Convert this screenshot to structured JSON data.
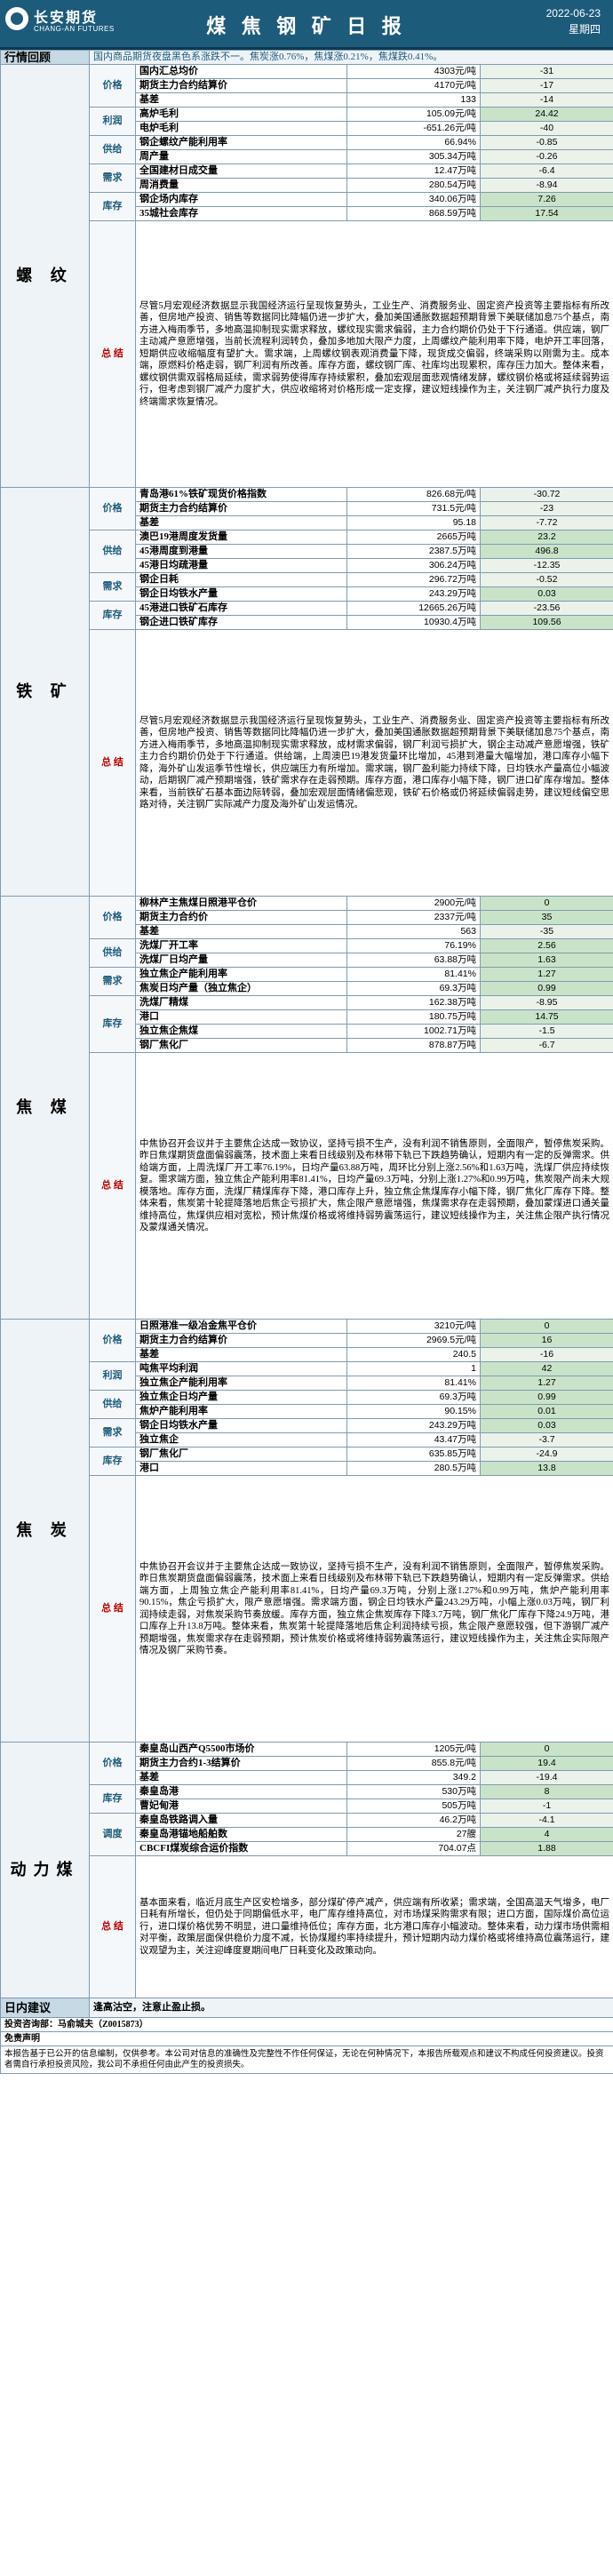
{
  "header": {
    "brand_cn": "长安期货",
    "brand_en": "CHANG-AN FUTURES",
    "title": "煤 焦 钢 矿 日 报",
    "date": "2022-06-23",
    "weekday": "星期四"
  },
  "review": {
    "label": "行情回顾",
    "text": "国内商品期货夜盘黑色系涨跌不一。焦炭涨0.76%，焦煤涨0.21%，焦煤跌0.41%。"
  },
  "sections": [
    {
      "name": "螺 纹",
      "rows": [
        {
          "cat": "价格",
          "item": "国内汇总均价",
          "value": "4303元/吨",
          "change": "-31"
        },
        {
          "cat": "",
          "item": "期货主力合约结算价",
          "value": "4170元/吨",
          "change": "-17"
        },
        {
          "cat": "",
          "item": "基差",
          "value": "133",
          "change": "-14"
        },
        {
          "cat": "利润",
          "item": "高炉毛利",
          "value": "105.09元/吨",
          "change": "24.42"
        },
        {
          "cat": "",
          "item": "电炉毛利",
          "value": "-651.26元/吨",
          "change": "-40"
        },
        {
          "cat": "供给",
          "item": "钢企螺纹产能利用率",
          "value": "66.94%",
          "change": "-0.85"
        },
        {
          "cat": "",
          "item": "周产量",
          "value": "305.34万吨",
          "change": "-0.26"
        },
        {
          "cat": "需求",
          "item": "全国建材日成交量",
          "value": "12.47万吨",
          "change": "-6.4"
        },
        {
          "cat": "",
          "item": "周消费量",
          "value": "280.54万吨",
          "change": "-8.94"
        },
        {
          "cat": "库存",
          "item": "钢企场内库存",
          "value": "340.06万吨",
          "change": "7.26"
        },
        {
          "cat": "",
          "item": "35城社会库存",
          "value": "868.59万吨",
          "change": "17.54"
        }
      ],
      "summary": "尽管5月宏观经济数据显示我国经济运行呈现恢复势头，工业生产、消费服务业、固定资产投资等主要指标有所改善，但房地产投资、销售等数据同比降幅仍进一步扩大，叠加美国通胀数据超预期背景下美联储加息75个基点，南方进入梅雨季节，多地高温抑制现实需求释放，螺纹现实需求偏弱，主力合约期价仍处于下行通道。供应端，钢厂主动减产意愿增强，当前长流程利润转负，叠加多地加大限产力度，上周螺纹产能利用率下降，电炉开工率回落，短期供应收缩幅度有望扩大。需求端，上周螺纹钢表观消费量下降，现货成交偏弱，终端采购以刚需为主。成本端，原燃料价格走弱，钢厂利润有所改善。库存方面，螺纹钢厂库、社库均出现累积，库存压力加大。整体来看，螺纹钢供需双弱格局延续，需求弱势使得库存持续累积，叠加宏观层面悲观情绪发酵，螺纹钢价格或将延续弱势运行，但考虑到钢厂减产力度扩大，供应收缩将对价格形成一定支撑，建议短线操作为主，关注钢厂减产执行力度及终端需求恢复情况。"
    },
    {
      "name": "铁 矿",
      "rows": [
        {
          "cat": "价格",
          "item": "青岛港61%铁矿现货价格指数",
          "value": "826.68元/吨",
          "change": "-30.72"
        },
        {
          "cat": "",
          "item": "期货主力合约结算价",
          "value": "731.5元/吨",
          "change": "-23"
        },
        {
          "cat": "",
          "item": "基差",
          "value": "95.18",
          "change": "-7.72"
        },
        {
          "cat": "供给",
          "item": "澳巴19港周度发货量",
          "value": "2665万吨",
          "change": "23.2"
        },
        {
          "cat": "",
          "item": "45港周度到港量",
          "value": "2387.5万吨",
          "change": "496.8"
        },
        {
          "cat": "",
          "item": "45港日均疏港量",
          "value": "306.24万吨",
          "change": "-12.35"
        },
        {
          "cat": "需求",
          "item": "钢企日耗",
          "value": "296.72万吨",
          "change": "-0.52"
        },
        {
          "cat": "",
          "item": "钢企日均铁水产量",
          "value": "243.29万吨",
          "change": "0.03"
        },
        {
          "cat": "库存",
          "item": "45港进口铁矿石库存",
          "value": "12665.26万吨",
          "change": "-23.56"
        },
        {
          "cat": "",
          "item": "钢企进口铁矿库存",
          "value": "10930.4万吨",
          "change": "109.56"
        }
      ],
      "summary": "尽管5月宏观经济数据显示我国经济运行呈现恢复势头，工业生产、消费服务业、固定资产投资等主要指标有所改善，但房地产投资、销售等数据同比降幅仍进一步扩大，叠加美国通胀数据超预期背景下美联储加息75个基点，南方进入梅雨季节，多地高温抑制现实需求释放，成材需求偏弱，钢厂利润亏损扩大，钢企主动减产意愿增强，铁矿主力合约期价仍处于下行通道。供给端，上周澳巴19港发货量环比增加，45港到港量大幅增加，港口库存小幅下降，海外矿山发运季节性增长，供应端压力有所增加。需求端，钢厂盈利能力持续下降，日均铁水产量高位小幅波动，后期钢厂减产预期增强，铁矿需求存在走弱预期。库存方面，港口库存小幅下降，钢厂进口矿库存增加。整体来看，当前铁矿石基本面边际转弱，叠加宏观层面情绪偏悲观，铁矿石价格或仍将延续偏弱走势，建议短线偏空思路对待，关注钢厂实际减产力度及海外矿山发运情况。"
    },
    {
      "name": "焦 煤",
      "rows": [
        {
          "cat": "价格",
          "item": "柳林产主焦煤日照港平仓价",
          "value": "2900元/吨",
          "change": "0"
        },
        {
          "cat": "",
          "item": "期货主力合约价",
          "value": "2337元/吨",
          "change": "35"
        },
        {
          "cat": "",
          "item": "基差",
          "value": "563",
          "change": "-35"
        },
        {
          "cat": "供给",
          "item": "洗煤厂开工率",
          "value": "76.19%",
          "change": "2.56"
        },
        {
          "cat": "",
          "item": "洗煤厂日均产量",
          "value": "63.88万吨",
          "change": "1.63"
        },
        {
          "cat": "需求",
          "item": "独立焦企产能利用率",
          "value": "81.41%",
          "change": "1.27"
        },
        {
          "cat": "",
          "item": "焦炭日均产量（独立焦企）",
          "value": "69.3万吨",
          "change": "0.99"
        },
        {
          "cat": "库存",
          "item": "洗煤厂精煤",
          "value": "162.38万吨",
          "change": "-8.95"
        },
        {
          "cat": "",
          "item": "港口",
          "value": "180.75万吨",
          "change": "14.75"
        },
        {
          "cat": "",
          "item": "独立焦企焦煤",
          "value": "1002.71万吨",
          "change": "-1.5"
        },
        {
          "cat": "",
          "item": "钢厂焦化厂",
          "value": "878.87万吨",
          "change": "-6.7"
        }
      ],
      "summary": "中焦协召开会议并于主要焦企达成一致协议，坚持亏损不生产，没有利润不销售原则，全面限产，暂停焦炭采购。昨日焦煤期货盘面偏弱震荡，技术面上来看日线级别及布林带下轨已下跌趋势确认，短期内有一定的反弹需求。供给端方面，上周洗煤厂开工率76.19%，日均产量63.88万吨，周环比分别上涨2.56%和1.63万吨，洗煤厂供应持续恢复。需求端方面，独立焦企产能利用率81.41%，日均产量69.3万吨，分别上涨1.27%和0.99万吨，焦炭限产尚未大规模落地。库存方面，洗煤厂精煤库存下降，港口库存上升，独立焦企焦煤库存小幅下降，钢厂焦化厂库存下降。整体来看，焦炭第十轮提降落地后焦企亏损扩大，焦企限产意愿增强，焦煤需求存在走弱预期，叠加蒙煤进口通关量维持高位，焦煤供应相对宽松，预计焦煤价格或将维持弱势震荡运行，建议短线操作为主，关注焦企限产执行情况及蒙煤通关情况。"
    },
    {
      "name": "焦 炭",
      "rows": [
        {
          "cat": "价格",
          "item": "日照港准一级冶金焦平仓价",
          "value": "3210元/吨",
          "change": "0"
        },
        {
          "cat": "",
          "item": "期货主力合约结算价",
          "value": "2969.5元/吨",
          "change": "16"
        },
        {
          "cat": "",
          "item": "基差",
          "value": "240.5",
          "change": "-16"
        },
        {
          "cat": "利润",
          "item": "吨焦平均利润",
          "value": "1",
          "change": "42"
        },
        {
          "cat": "",
          "item": "独立焦企产能利用率",
          "value": "81.41%",
          "change": "1.27"
        },
        {
          "cat": "供给",
          "item": "独立焦企日均产量",
          "value": "69.3万吨",
          "change": "0.99"
        },
        {
          "cat": "",
          "item": "焦炉产能利用率",
          "value": "90.15%",
          "change": "0.01"
        },
        {
          "cat": "需求",
          "item": "钢企日均铁水产量",
          "value": "243.29万吨",
          "change": "0.03"
        },
        {
          "cat": "",
          "item": "独立焦企",
          "value": "43.47万吨",
          "change": "-3.7"
        },
        {
          "cat": "库存",
          "item": "钢厂焦化厂",
          "value": "635.85万吨",
          "change": "-24.9"
        },
        {
          "cat": "",
          "item": "港口",
          "value": "280.5万吨",
          "change": "13.8"
        }
      ],
      "summary": "中焦协召开会议并于主要焦企达成一致协议，坚持亏损不生产，没有利润不销售原则，全面限产，暂停焦炭采购。昨日焦炭期货盘面偏弱震荡，技术面上来看日线级别及布林带下轨已下跌趋势确认，短期内有一定反弹需求。供给端方面，上周独立焦企产能利用率81.41%，日均产量69.3万吨，分别上涨1.27%和0.99万吨，焦炉产能利用率90.15%，焦企亏损扩大，限产意愿增强。需求端方面，钢企日均铁水产量243.29万吨，小幅上涨0.03万吨，钢厂利润持续走弱，对焦炭采购节奏放缓。库存方面，独立焦企焦炭库存下降3.7万吨，钢厂焦化厂库存下降24.9万吨，港口库存上升13.8万吨。整体来看，焦炭第十轮提降落地后焦企利润持续亏损，焦企限产意愿较强，但下游钢厂减产预期增强，焦炭需求存在走弱预期，预计焦炭价格或将维持弱势震荡运行，建议短线操作为主，关注焦企实际限产情况及钢厂采购节奏。"
    },
    {
      "name": "动力煤",
      "rows": [
        {
          "cat": "价格",
          "item": "秦皇岛山西产Q5500市场价",
          "value": "1205元/吨",
          "change": "0"
        },
        {
          "cat": "",
          "item": "期货主力合约1-3结算价",
          "value": "855.8元/吨",
          "change": "19.4"
        },
        {
          "cat": "",
          "item": "基差",
          "value": "349.2",
          "change": "-19.4"
        },
        {
          "cat": "库存",
          "item": "秦皇岛港",
          "value": "530万吨",
          "change": "8"
        },
        {
          "cat": "",
          "item": "曹妃甸港",
          "value": "505万吨",
          "change": "-1"
        },
        {
          "cat": "调度",
          "item": "秦皇岛铁路调入量",
          "value": "46.2万吨",
          "change": "-4.1"
        },
        {
          "cat": "",
          "item": "秦皇岛港锚地船舶数",
          "value": "27艘",
          "change": "4"
        },
        {
          "cat": "",
          "item": "CBCFI煤炭综合运价指数",
          "value": "704.07点",
          "change": "1.88"
        }
      ],
      "summary": "基本面来看，临近月底生产区安检增多，部分煤矿停产减产，供应端有所收紧；需求端，全国高温天气增多，电厂日耗有所增长，但仍处于同期偏低水平，电厂库存维持高位，对市场煤采购需求有限；进口方面，国际煤价高位运行，进口煤价格优势不明显，进口量维持低位；库存方面，北方港口库存小幅波动。整体来看，动力煤市场供需相对平衡，政策层面保供稳价力度不减，长协煤履约率持续提升，预计短期内动力煤价格或将维持高位震荡运行，建议观望为主，关注迎峰度夏期间电厂日耗变化及政策动向。"
    }
  ],
  "labels": {
    "summary": "总 结"
  },
  "advice": {
    "label": "日内建议",
    "text": "逢高沽空，注意止盈止损。"
  },
  "analyst": "投资咨询部：马俞城夫（Z0015873）",
  "disclaimer_title": "免责声明",
  "disclaimer": "本报告基于已公开的信息编制，仅供参考。本公司对信息的准确性及完整性不作任何保证，无论在何种情况下，本报告所载观点和建议不构成任何投资建议。投资者需自行承担投资风险，我公司不承担任何由此产生的投资损失。"
}
